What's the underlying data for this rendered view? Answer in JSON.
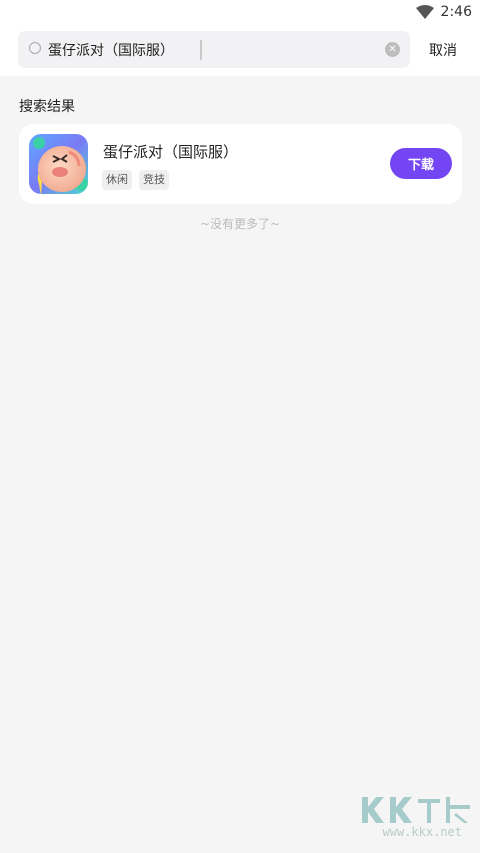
{
  "status_bar": {
    "time": "2:46",
    "wifi_icon": "wifi-icon"
  },
  "search": {
    "value": "蛋仔派对（国际服）",
    "cancel_label": "取消",
    "search_icon": "search-icon",
    "clear_icon": "clear-icon"
  },
  "results": {
    "section_title": "搜索结果",
    "items": [
      {
        "name": "蛋仔派对（国际服）",
        "tags": [
          "休闲",
          "竞技"
        ],
        "button_label": "下载",
        "icon": "app-icon"
      }
    ],
    "end_text": "~没有更多了~"
  },
  "watermark": {
    "url": "www.kkx.net"
  },
  "colors": {
    "accent": "#7446f3",
    "background": "#f5f5f5",
    "card": "#ffffff"
  }
}
